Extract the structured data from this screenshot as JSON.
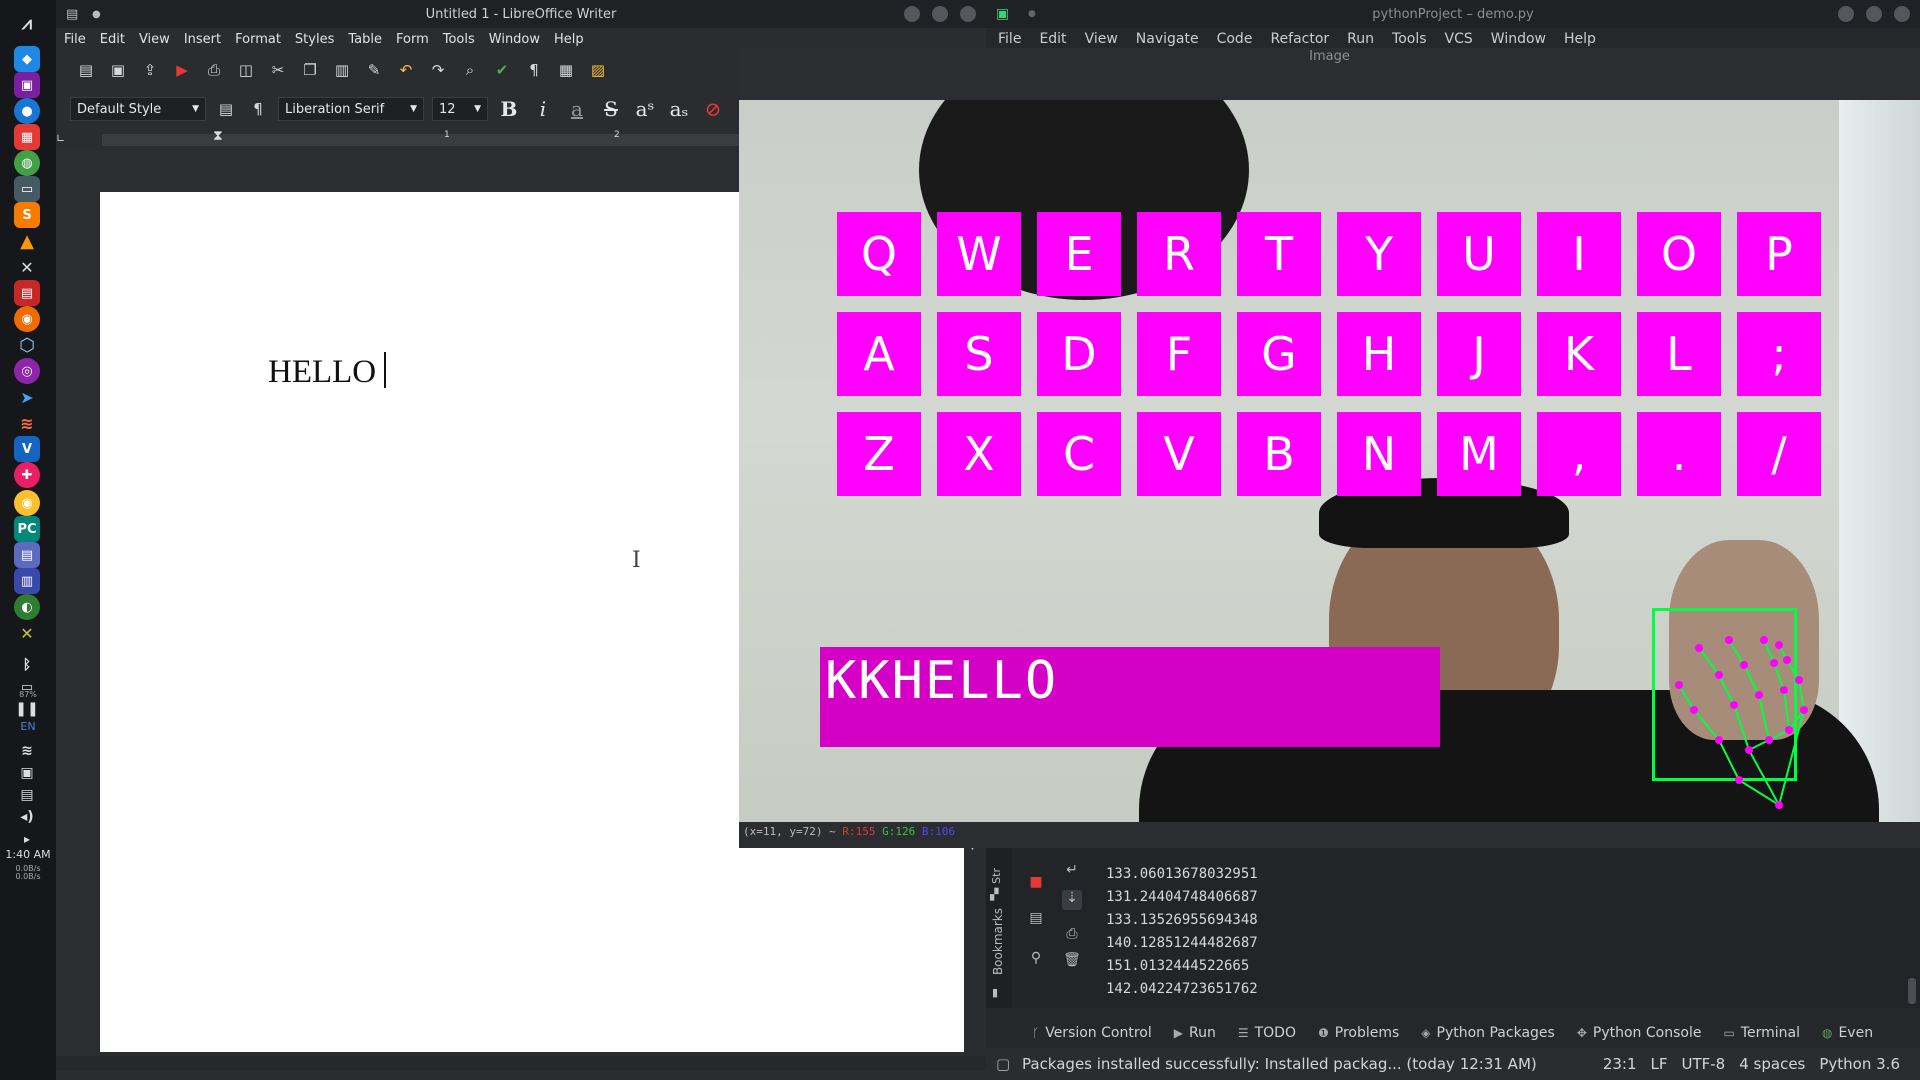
{
  "desktop": {
    "clock": "1:40 AM",
    "net_up": "0.0B/s",
    "net_down": "0.0B/s",
    "lang": "EN",
    "battery": "87%"
  },
  "writer": {
    "title": "Untitled 1 - LibreOffice Writer",
    "menu": [
      "File",
      "Edit",
      "View",
      "Insert",
      "Format",
      "Styles",
      "Table",
      "Form",
      "Tools",
      "Window",
      "Help"
    ],
    "paragraph_style": "Default Style",
    "font_name": "Liberation Serif",
    "font_size": "12",
    "ruler_marks": [
      "1",
      "2"
    ],
    "doc_text": "HELLO"
  },
  "pycharm": {
    "title": "pythonProject – demo.py",
    "menu": [
      "File",
      "Edit",
      "View",
      "Navigate",
      "Code",
      "Refactor",
      "Run",
      "Tools",
      "VCS",
      "Window",
      "Help"
    ],
    "side_labels": {
      "structure": "Str",
      "bookmarks": "Bookmarks"
    },
    "console_lines": [
      "133.06013678032951",
      "131.24404748406687",
      "133.13526955694348",
      "140.12851244482687",
      "151.0132444522665",
      "142.04224723651762"
    ],
    "tool_tabs": [
      "Version Control",
      "Run",
      "TODO",
      "Problems",
      "Python Packages",
      "Python Console",
      "Terminal",
      "Even"
    ],
    "status_message": "Packages installed successfully: Installed packag... (today 12:31 AM)",
    "status_right": {
      "position": "23:1",
      "line_sep": "LF",
      "encoding": "UTF-8",
      "indent": "4 spaces",
      "interpreter": "Python 3.6"
    }
  },
  "cv_window": {
    "title": "Image",
    "keyboard_rows": [
      [
        "Q",
        "W",
        "E",
        "R",
        "T",
        "Y",
        "U",
        "I",
        "O",
        "P"
      ],
      [
        "A",
        "S",
        "D",
        "F",
        "G",
        "H",
        "J",
        "K",
        "L",
        ";"
      ],
      [
        "Z",
        "X",
        "C",
        "V",
        "B",
        "N",
        "M",
        ",",
        ".",
        "/"
      ]
    ],
    "typed_text": "KKHELLO",
    "status_coords": "(x=11, y=72) ~",
    "status_r": "R:155",
    "status_g": "G:126",
    "status_b": "B:106",
    "colors": {
      "key": "#ff00ff",
      "typed_box": "#d400c5",
      "hand_box": "#00ff40",
      "landmark": "#ff00ff",
      "skeleton": "#00ff40"
    }
  }
}
